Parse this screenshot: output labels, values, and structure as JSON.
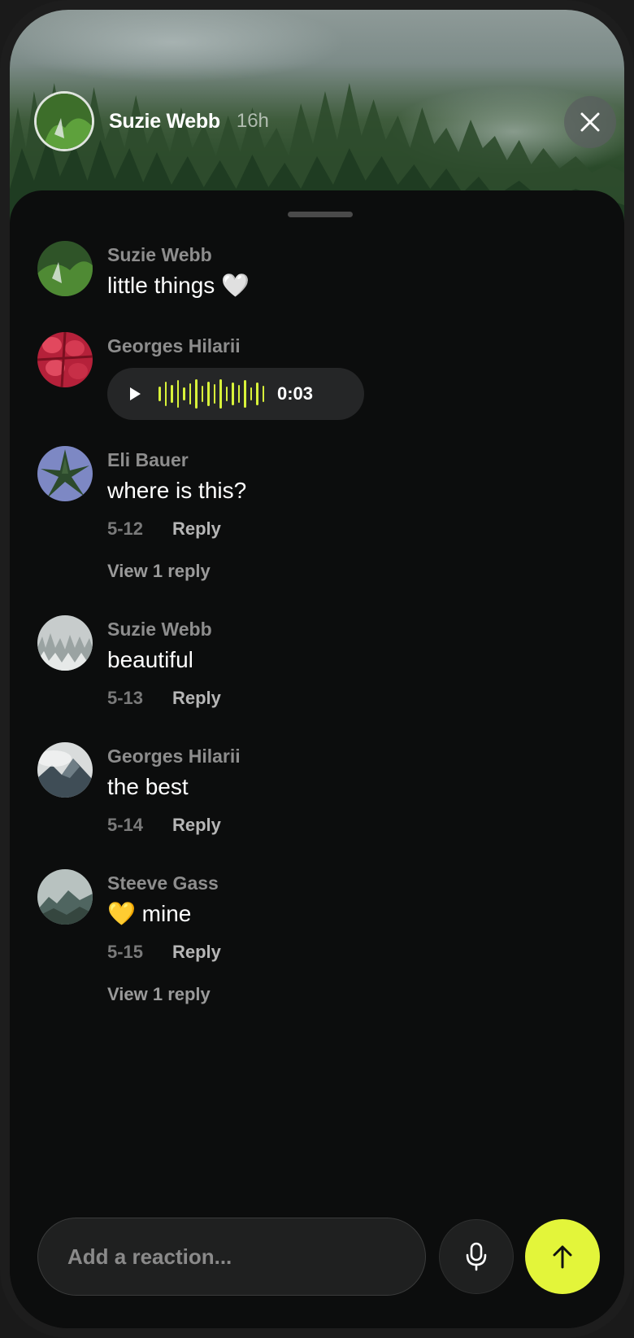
{
  "story": {
    "author": "Suzie Webb",
    "time": "16h"
  },
  "comments": [
    {
      "author": "Suzie Webb",
      "text": "little things 🤍"
    },
    {
      "author": "Georges Hilarii",
      "voice_duration": "0:03"
    },
    {
      "author": "Eli Bauer",
      "text": "where is this?",
      "date": "5-12",
      "reply_label": "Reply",
      "view_replies": "View 1 reply"
    },
    {
      "author": "Suzie Webb",
      "text": "beautiful",
      "date": "5-13",
      "reply_label": "Reply"
    },
    {
      "author": "Georges Hilarii",
      "text": "the best",
      "date": "5-14",
      "reply_label": "Reply"
    },
    {
      "author": "Steeve Gass",
      "text": "💛 mine",
      "date": "5-15",
      "reply_label": "Reply",
      "view_replies": "View 1 reply"
    }
  ],
  "composer": {
    "placeholder": "Add a reaction..."
  },
  "icons": {
    "close": "close-icon",
    "mic": "microphone-icon",
    "send": "arrow-up-icon",
    "play": "play-icon"
  },
  "colors": {
    "accent": "#e3f53a",
    "waveform": "#d8f23a",
    "sheet_bg": "#0c0d0d"
  }
}
